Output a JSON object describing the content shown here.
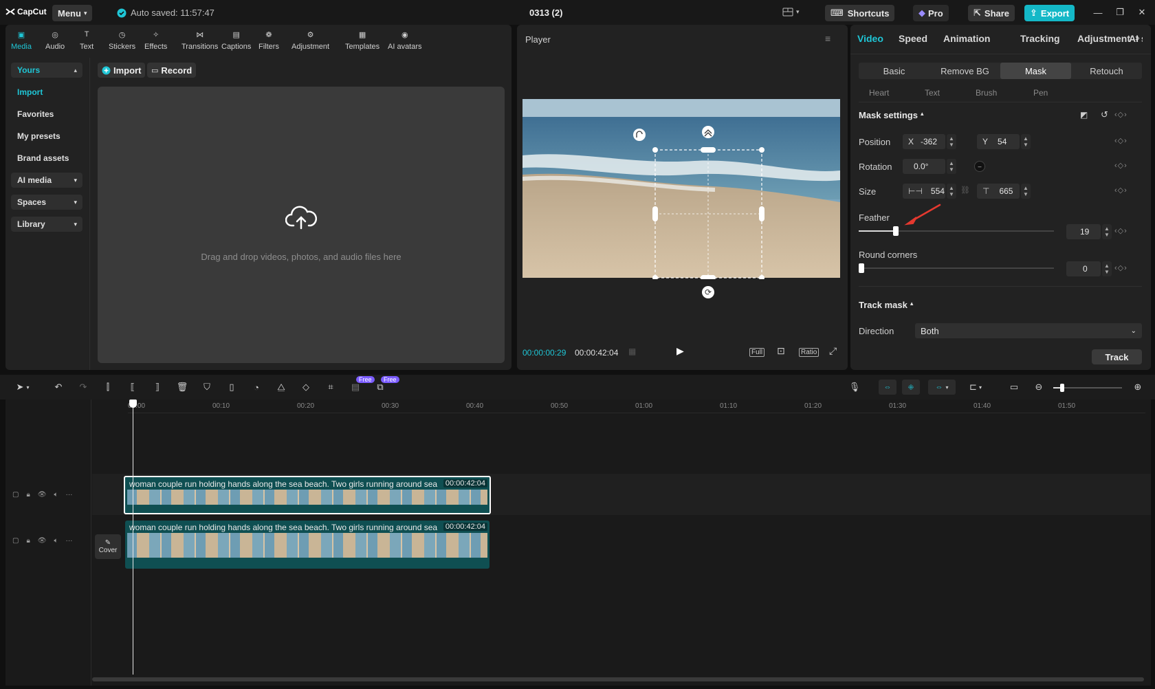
{
  "app": {
    "logo": "CapCut",
    "menu_label": "Menu",
    "autosave": "Auto saved: 11:57:47",
    "project_title": "0313 (2)",
    "shortcuts_label": "Shortcuts",
    "pro_label": "Pro",
    "share_label": "Share",
    "export_label": "Export"
  },
  "media": {
    "tools": [
      {
        "label": "Media",
        "icon": "media-icon"
      },
      {
        "label": "Audio",
        "icon": "audio-icon"
      },
      {
        "label": "Text",
        "icon": "text-icon"
      },
      {
        "label": "Stickers",
        "icon": "stickers-icon"
      },
      {
        "label": "Effects",
        "icon": "effects-icon"
      },
      {
        "label": "Transitions",
        "icon": "transitions-icon"
      },
      {
        "label": "Captions",
        "icon": "captions-icon"
      },
      {
        "label": "Filters",
        "icon": "filters-icon"
      },
      {
        "label": "Adjustment",
        "icon": "adjustment-icon"
      },
      {
        "label": "Templates",
        "icon": "templates-icon"
      },
      {
        "label": "AI avatars",
        "icon": "ai-avatars-icon"
      }
    ],
    "sidebar": {
      "yours": "Yours",
      "import": "Import",
      "favorites": "Favorites",
      "my_presets": "My presets",
      "brand_assets": "Brand assets",
      "ai_media": "AI media",
      "spaces": "Spaces",
      "library": "Library"
    },
    "import_btn": "Import",
    "record_btn": "Record",
    "drop_hint": "Drag and drop videos, photos, and audio files here"
  },
  "player": {
    "title": "Player",
    "current_time": "00:00:00:29",
    "total_time": "00:00:42:04",
    "full_label": "Full",
    "ratio_label": "Ratio"
  },
  "props": {
    "tabs": [
      "Video",
      "Speed",
      "Animation",
      "Tracking",
      "Adjustment",
      "AI st"
    ],
    "segments": [
      "Basic",
      "Remove BG",
      "Mask",
      "Retouch"
    ],
    "mask_types": [
      "Heart",
      "Text",
      "Brush",
      "Pen"
    ],
    "mask_settings_label": "Mask settings",
    "position_label": "Position",
    "pos_x_label": "X",
    "pos_x": "-362",
    "pos_y_label": "Y",
    "pos_y": "54",
    "rotation_label": "Rotation",
    "rotation": "0.0°",
    "size_label": "Size",
    "size_w": "554",
    "size_h": "665",
    "feather_label": "Feather",
    "feather": "19",
    "feather_pct": 19,
    "round_corners_label": "Round corners",
    "round_corners": "0",
    "track_mask_label": "Track mask",
    "direction_label": "Direction",
    "direction_value": "Both",
    "track_btn": "Track"
  },
  "timeline": {
    "free_badge": "Free",
    "ruler": [
      "00:00",
      "00:10",
      "00:20",
      "00:30",
      "00:40",
      "00:50",
      "01:00",
      "01:10",
      "01:20",
      "01:30",
      "01:40",
      "01:50"
    ],
    "clips": [
      {
        "title": "woman couple run holding hands along the sea beach. Two girls running around sea",
        "duration": "00:00:42:04"
      },
      {
        "title": "woman couple run holding hands along the sea beach. Two girls running around sea",
        "duration": "00:00:42:04"
      }
    ],
    "cover_label": "Cover"
  },
  "colors": {
    "accent": "#1fc6d6",
    "export": "#14b8c7",
    "panel": "#222222",
    "clip": "#0f4f52"
  }
}
